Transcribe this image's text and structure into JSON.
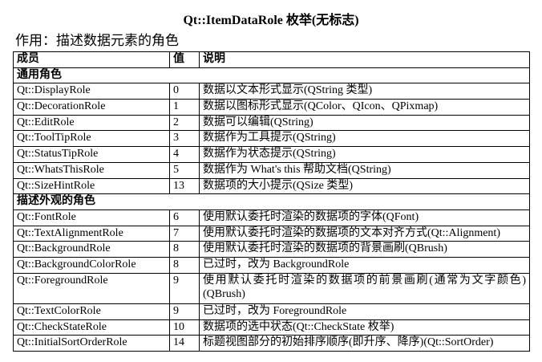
{
  "title": "Qt::ItemDataRole 枚举(无标志)",
  "subtitle": "作用：描述数据元素的角色",
  "headers": {
    "member": "成员",
    "value": "值",
    "desc": "说明"
  },
  "groups": [
    {
      "label": "通用角色",
      "rows": [
        {
          "member": "Qt::DisplayRole",
          "value": "0",
          "desc": "数据以文本形式显示(QString 类型)"
        },
        {
          "member": "Qt::DecorationRole",
          "value": "1",
          "desc": "数据以图标形式显示(QColor、QIcon、QPixmap)"
        },
        {
          "member": "Qt::EditRole",
          "value": "2",
          "desc": "数据可以编辑(QString)"
        },
        {
          "member": "Qt::ToolTipRole",
          "value": "3",
          "desc": "数据作为工具提示(QString)"
        },
        {
          "member": "Qt::StatusTipRole",
          "value": "4",
          "desc": "数据作为状态提示(QString)"
        },
        {
          "member": "Qt::WhatsThisRole",
          "value": "5",
          "desc": "数据作为 What's this 帮助文档(QString)"
        },
        {
          "member": "Qt::SizeHintRole",
          "value": "13",
          "desc": "数据项的大小提示(QSize 类型)"
        }
      ]
    },
    {
      "label": "描述外观的角色",
      "rows": [
        {
          "member": "Qt::FontRole",
          "value": "6",
          "desc": "使用默认委托时渲染的数据项的字体(QFont)"
        },
        {
          "member": "Qt::TextAlignmentRole",
          "value": "7",
          "desc": "使用默认委托时渲染的数据项的文本对齐方式(Qt::Alignment)"
        },
        {
          "member": "Qt::BackgroundRole",
          "value": "8",
          "desc": "使用默认委托时渲染的数据项的背景画刷(QBrush)"
        },
        {
          "member": "Qt::BackgroundColorRole",
          "value": "8",
          "desc": "已过时，改为 BackgroundRole"
        },
        {
          "member": "Qt::ForegroundRole",
          "value": "9",
          "desc": "使用默认委托时渲染的数据项的前景画刷(通常为文字颜色)(QBrush)"
        },
        {
          "member": "Qt::TextColorRole",
          "value": "9",
          "desc": "已过时，改为 ForegroundRole"
        },
        {
          "member": "Qt::CheckStateRole",
          "value": "10",
          "desc": "数据项的选中状态(Qt::CheckState 枚举)"
        },
        {
          "member": "Qt::InitialSortOrderRole",
          "value": "14",
          "desc": "标题视图部分的初始排序顺序(即升序、降序)(Qt::SortOrder)"
        }
      ]
    }
  ]
}
